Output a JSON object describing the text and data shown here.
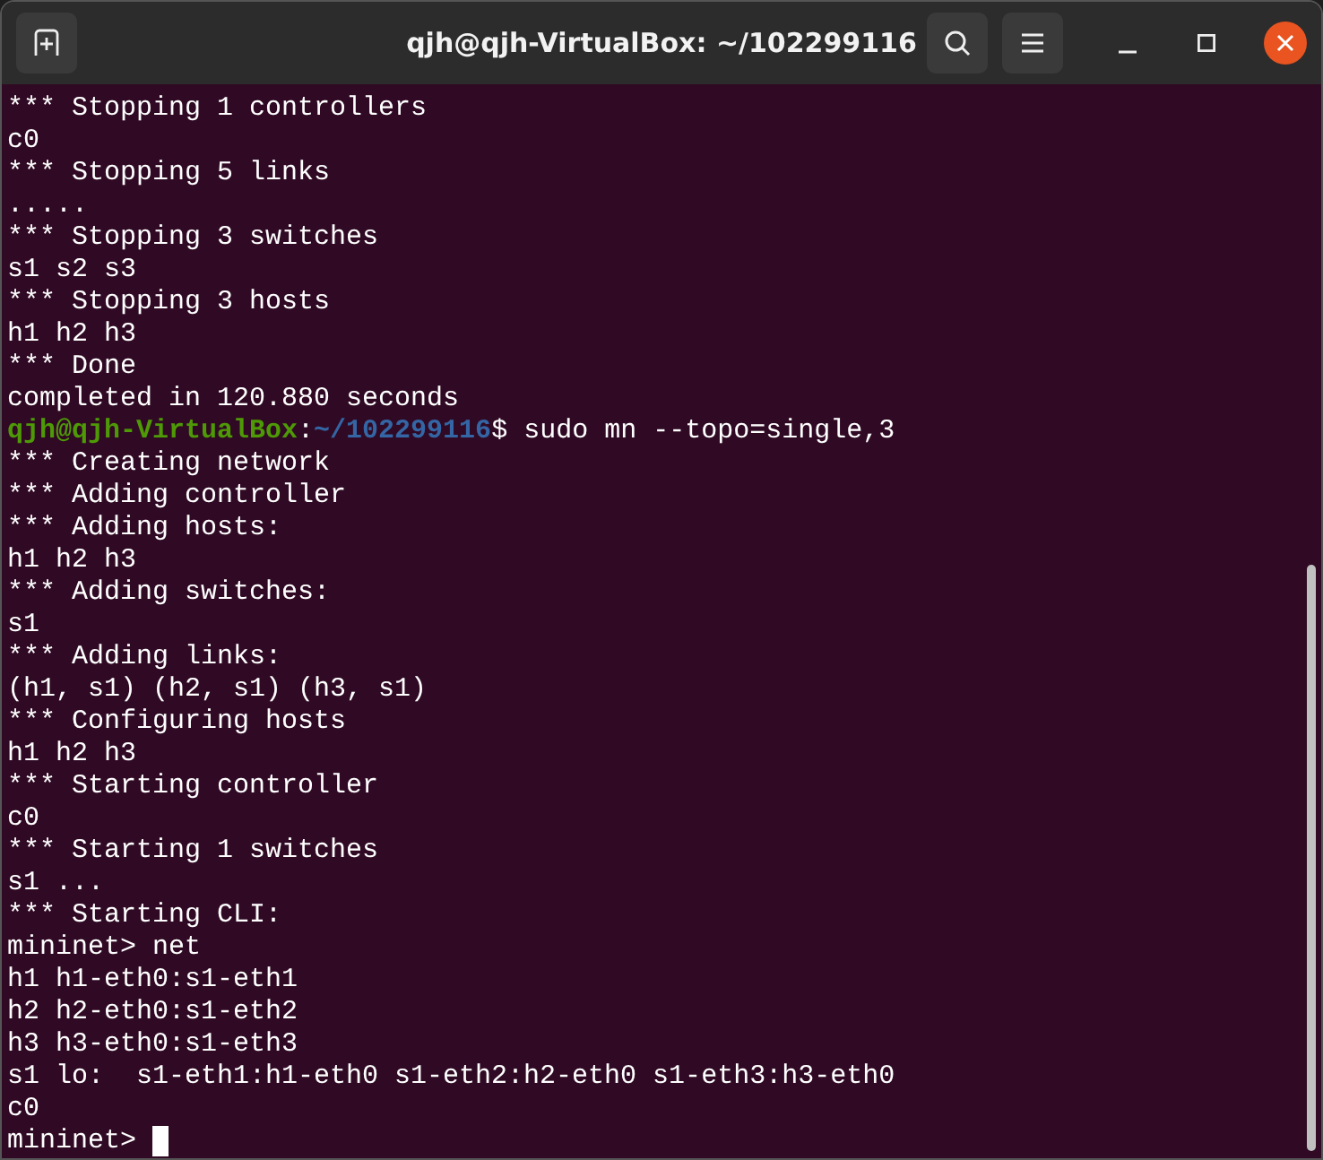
{
  "window": {
    "title": "qjh@qjh-VirtualBox: ~/102299116"
  },
  "terminal": {
    "lines": [
      {
        "kind": "output",
        "text": "*** Stopping 1 controllers"
      },
      {
        "kind": "output",
        "text": "c0"
      },
      {
        "kind": "output",
        "text": "*** Stopping 5 links"
      },
      {
        "kind": "output",
        "text": "....."
      },
      {
        "kind": "output",
        "text": "*** Stopping 3 switches"
      },
      {
        "kind": "output",
        "text": "s1 s2 s3"
      },
      {
        "kind": "output",
        "text": "*** Stopping 3 hosts"
      },
      {
        "kind": "output",
        "text": "h1 h2 h3"
      },
      {
        "kind": "output",
        "text": "*** Done"
      },
      {
        "kind": "output",
        "text": "completed in 120.880 seconds"
      },
      {
        "kind": "prompt",
        "user": "qjh@qjh-VirtualBox",
        "separator": ":",
        "path": "~/102299116",
        "sigil": "$",
        "command": "sudo mn --topo=single,3"
      },
      {
        "kind": "output",
        "text": "*** Creating network"
      },
      {
        "kind": "output",
        "text": "*** Adding controller"
      },
      {
        "kind": "output",
        "text": "*** Adding hosts:"
      },
      {
        "kind": "output",
        "text": "h1 h2 h3"
      },
      {
        "kind": "output",
        "text": "*** Adding switches:"
      },
      {
        "kind": "output",
        "text": "s1"
      },
      {
        "kind": "output",
        "text": "*** Adding links:"
      },
      {
        "kind": "output",
        "text": "(h1, s1) (h2, s1) (h3, s1)"
      },
      {
        "kind": "output",
        "text": "*** Configuring hosts"
      },
      {
        "kind": "output",
        "text": "h1 h2 h3"
      },
      {
        "kind": "output",
        "text": "*** Starting controller"
      },
      {
        "kind": "output",
        "text": "c0"
      },
      {
        "kind": "output",
        "text": "*** Starting 1 switches"
      },
      {
        "kind": "output",
        "text": "s1 ..."
      },
      {
        "kind": "output",
        "text": "*** Starting CLI:"
      },
      {
        "kind": "output",
        "text": "mininet> net"
      },
      {
        "kind": "output",
        "text": "h1 h1-eth0:s1-eth1"
      },
      {
        "kind": "output",
        "text": "h2 h2-eth0:s1-eth2"
      },
      {
        "kind": "output",
        "text": "h3 h3-eth0:s1-eth3"
      },
      {
        "kind": "output",
        "text": "s1 lo:  s1-eth1:h1-eth0 s1-eth2:h2-eth0 s1-eth3:h3-eth0"
      },
      {
        "kind": "output",
        "text": "c0"
      },
      {
        "kind": "input",
        "text": "mininet>"
      }
    ]
  }
}
